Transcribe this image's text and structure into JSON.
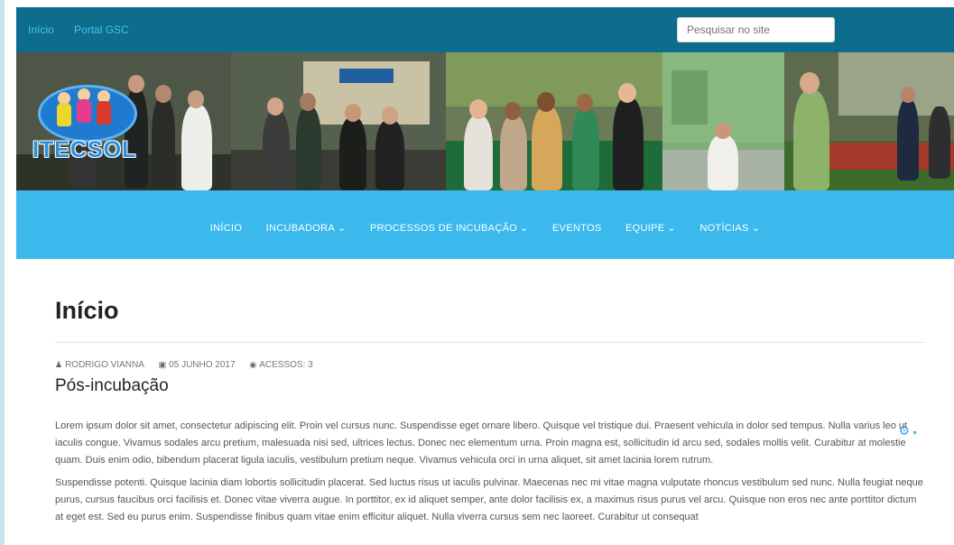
{
  "topbar": {
    "links": [
      "Início",
      "Portal GSC"
    ],
    "search_placeholder": "Pesquisar no site"
  },
  "logo": {
    "text": "ITECSOL"
  },
  "nav": {
    "items": [
      {
        "label": "INÍCIO",
        "has_dropdown": false,
        "active": true
      },
      {
        "label": "INCUBADORA",
        "has_dropdown": true,
        "active": false
      },
      {
        "label": "PROCESSOS DE INCUBAÇÃO",
        "has_dropdown": true,
        "active": false
      },
      {
        "label": "EVENTOS",
        "has_dropdown": false,
        "active": false
      },
      {
        "label": "EQUIPE",
        "has_dropdown": true,
        "active": false
      },
      {
        "label": "NOTÍCIAS",
        "has_dropdown": true,
        "active": false
      }
    ]
  },
  "page": {
    "title": "Início"
  },
  "article": {
    "author": "RODRIGO VIANNA",
    "date": "05 JUNHO 2017",
    "hits": "ACESSOS: 3",
    "title": "Pós-incubação",
    "paragraphs": [
      "Lorem ipsum dolor sit amet, consectetur adipiscing elit. Proin vel cursus nunc. Suspendisse eget ornare libero. Quisque vel tristique dui. Praesent vehicula in dolor sed tempus. Nulla varius leo ut iaculis congue. Vivamus sodales arcu pretium, malesuada nisi sed, ultrices lectus. Donec nec elementum urna. Proin magna est, sollicitudin id arcu sed, sodales mollis velit. Curabitur at molestie quam. Duis enim odio, bibendum placerat ligula iaculis, vestibulum pretium neque. Vivamus vehicula orci in urna aliquet, sit amet lacinia lorem rutrum.",
      "Suspendisse potenti. Quisque lacinia diam lobortis sollicitudin placerat. Sed luctus risus ut iaculis pulvinar. Maecenas nec mi vitae magna vulputate rhoncus vestibulum sed nunc. Nulla feugiat neque purus, cursus faucibus orci facilisis et. Donec vitae viverra augue. In porttitor, ex id aliquet semper, ante dolor facilisis ex, a maximus risus purus vel arcu. Quisque non eros nec ante porttitor dictum at eget est. Sed eu purus enim. Suspendisse finibus quam vitae enim efficitur aliquet. Nulla viverra cursus sem nec laoreet. Curabitur ut consequat"
    ]
  },
  "icons": {
    "author": "user-icon",
    "date": "calendar-icon",
    "hits": "eye-icon",
    "tools": "gear-icon"
  },
  "colors": {
    "topbar": "#0e6c8c",
    "nav": "#3bb9ec",
    "link": "#3fc3ec"
  }
}
